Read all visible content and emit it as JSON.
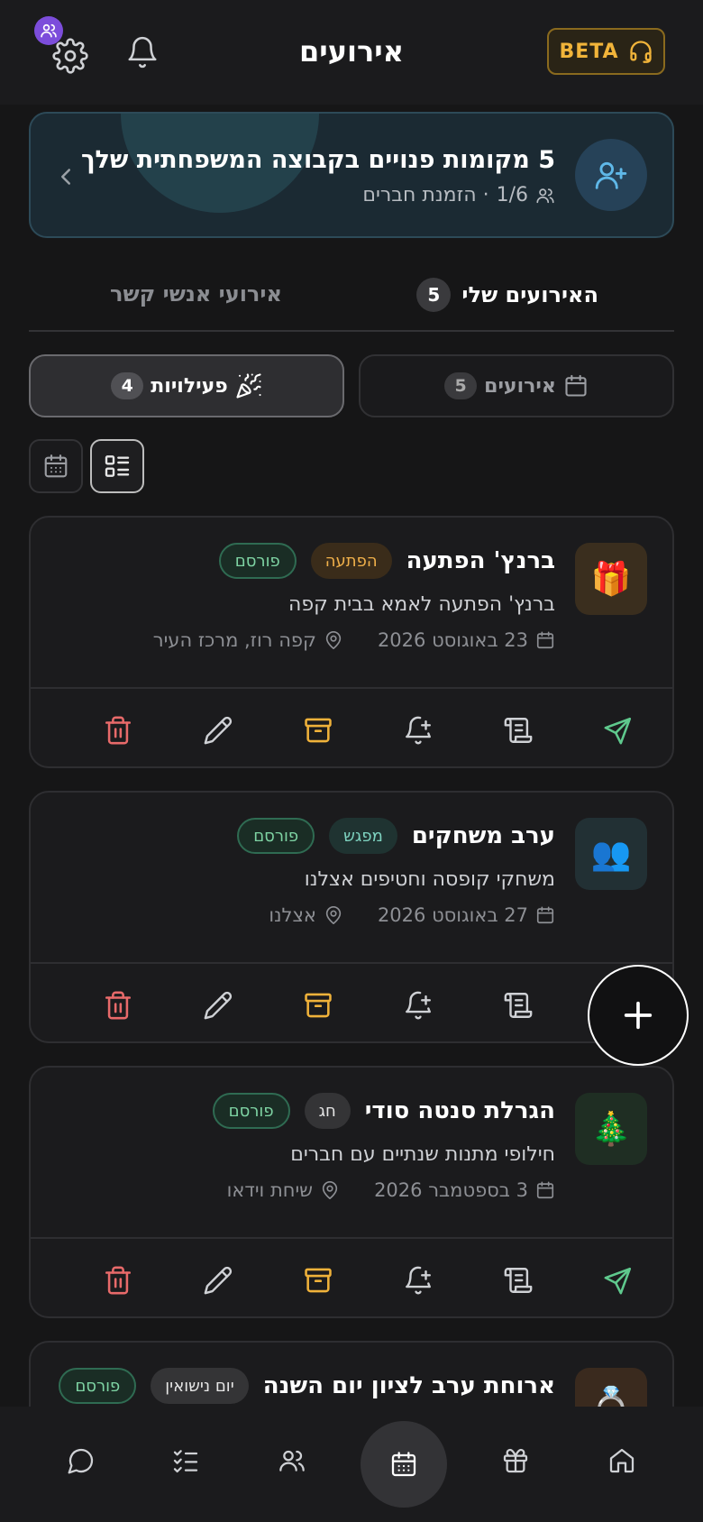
{
  "header": {
    "title": "אירועים",
    "beta_label": "BETA"
  },
  "banner": {
    "title": "5 מקומות פנויים בקבוצה המשפחתית שלך",
    "count": "1/6",
    "invite_label": "· הזמנת חברים"
  },
  "tabs": {
    "mine_label": "האירועים שלי",
    "mine_count": "5",
    "contacts_label": "אירועי אנשי קשר"
  },
  "segments": {
    "events_label": "אירועים",
    "events_count": "5",
    "activities_label": "פעילויות",
    "activities_count": "4"
  },
  "cards": [
    {
      "emoji": "🎁",
      "emoji_bg": "#3a2e1e",
      "title": "ברנץ' הפתעה",
      "category": "הפתעה",
      "category_color": "#f0b04a",
      "category_bg": "#3a2c1a",
      "status": "פורסם",
      "description": "ברנץ' הפתעה לאמא בבית קפה",
      "date": "23 באוגוסט 2026",
      "location": "קפה רוז, מרכז העיר"
    },
    {
      "emoji": "👥",
      "emoji_bg": "#223034",
      "title": "ערב משחקים",
      "category": "מפגש",
      "category_color": "#7ed3c0",
      "category_bg": "#1f3331",
      "status": "פורסם",
      "description": "משחקי קופסה וחטיפים אצלנו",
      "date": "27 באוגוסט 2026",
      "location": "אצלנו"
    },
    {
      "emoji": "🎄",
      "emoji_bg": "#1f2e23",
      "title": "הגרלת סנטה סודי",
      "category": "חג",
      "category_color": "#e6e6e6",
      "category_bg": "#343436",
      "status": "פורסם",
      "description": "חילופי מתנות שנתיים עם חברים",
      "date": "3 בספטמבר 2026",
      "location": "שיחת וידאו"
    },
    {
      "emoji": "💍",
      "emoji_bg": "#3a2a1e",
      "title": "ארוחת ערב לציון יום השנה",
      "category": "יום נישואין",
      "category_color": "#e6e6e6",
      "category_bg": "#343436",
      "status": "פורסם"
    }
  ],
  "colors": {
    "send": "#5fc98d",
    "archive": "#f0b23a",
    "delete": "#e86a6a",
    "accent_purple": "#7c4ddb"
  }
}
